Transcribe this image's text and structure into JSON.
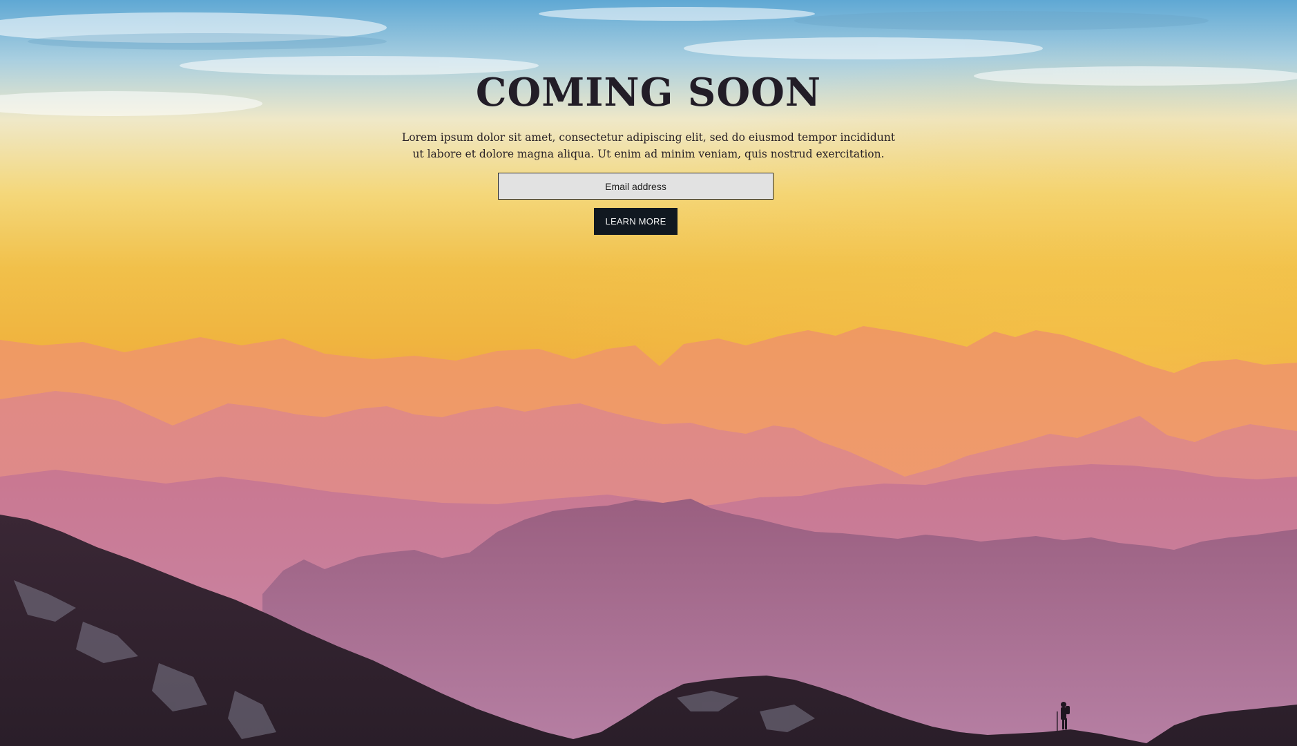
{
  "page": {
    "title": "COMING SOON",
    "description": "Lorem ipsum dolor sit amet, consectetur adipiscing elit, sed do eiusmod tempor incididunt ut labore et dolore magna aliqua. Ut enim ad minim veniam, quis nostrud exercitation."
  },
  "signup": {
    "email_placeholder": "Email address",
    "email_value": "",
    "button_label": "LEARN MORE"
  },
  "colors": {
    "title": "#221d27",
    "button_bg": "#111820",
    "input_bg": "#e2e2e2",
    "sky_top": "#5fa8d4",
    "sky_mid": "#f1c04a",
    "mountain_far": "#ea9a72",
    "mountain_mid": "#c87a8e",
    "mountain_near": "#8d5a7a",
    "ridge_dark": "#2e2130"
  }
}
